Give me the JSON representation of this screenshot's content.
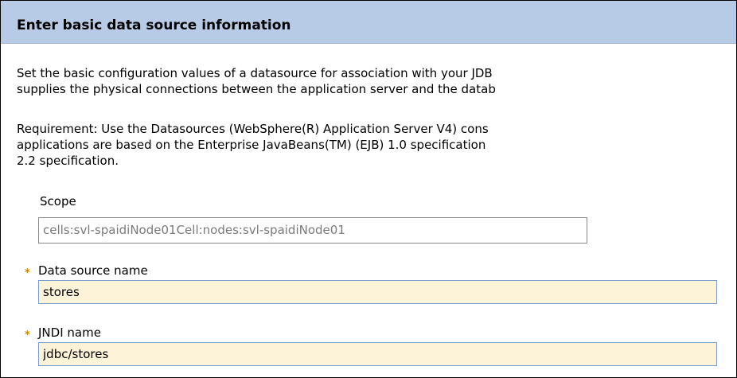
{
  "header": {
    "title": "Enter basic data source information"
  },
  "intro": {
    "line1": "Set the basic configuration values of a datasource for association with your JDB",
    "line2": "supplies the physical connections between the application server and the datab"
  },
  "requirement": {
    "line1": "Requirement: Use the Datasources (WebSphere(R) Application Server V4) cons",
    "line2": "applications are based on the Enterprise JavaBeans(TM) (EJB) 1.0 specification",
    "line3": "2.2 specification."
  },
  "form": {
    "scope": {
      "label": "Scope",
      "value": "cells:svl-spaidiNode01Cell:nodes:svl-spaidiNode01",
      "read_only": true
    },
    "data_source_name": {
      "label": "Data source name",
      "value": "stores",
      "required": true
    },
    "jndi_name": {
      "label": "JNDI name",
      "value": "jdbc/stores",
      "required": true
    },
    "required_marker": "*"
  },
  "colors": {
    "header_bg": "#b8cbe6",
    "required_field_bg": "#fdf3d8",
    "required_marker": "#c58a00",
    "field_border": "#7a9cc8"
  }
}
